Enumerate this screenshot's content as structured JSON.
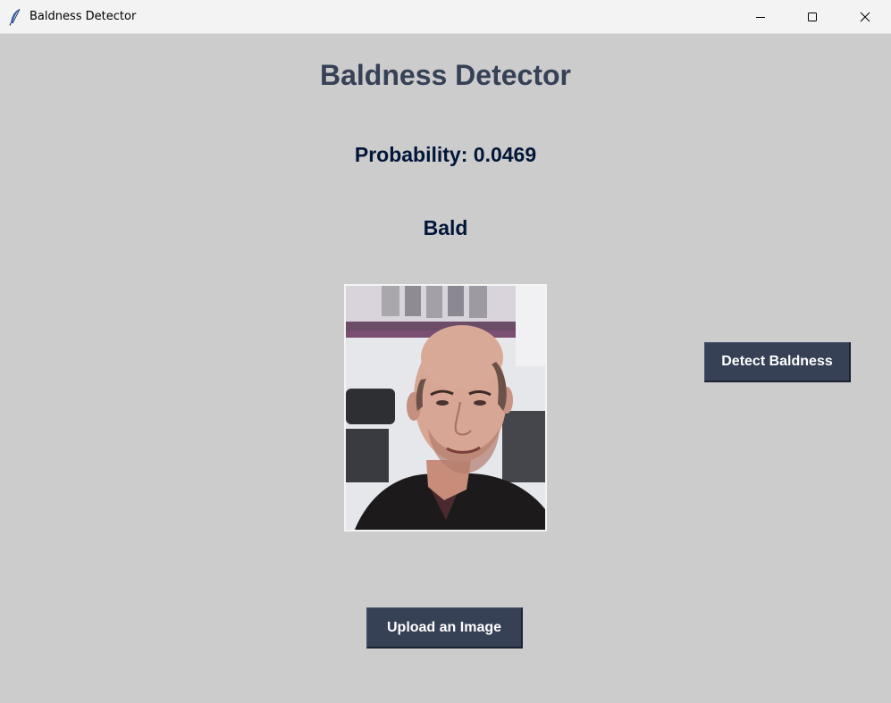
{
  "window": {
    "title": "Baldness Detector"
  },
  "main": {
    "heading": "Baldness Detector",
    "probability_text": "Probability: 0.0469",
    "result_label": "Bald",
    "detect_button_label": "Detect Baldness",
    "upload_button_label": "Upload an Image"
  },
  "icons": {
    "app": "feather-icon",
    "minimize": "minimize-icon",
    "maximize": "maximize-icon",
    "close": "close-icon"
  },
  "colors": {
    "background": "#cccccc",
    "heading": "#364156",
    "label": "#011638",
    "button": "#364156",
    "button_text": "#ffffff",
    "titlebar": "#f3f3f3"
  }
}
